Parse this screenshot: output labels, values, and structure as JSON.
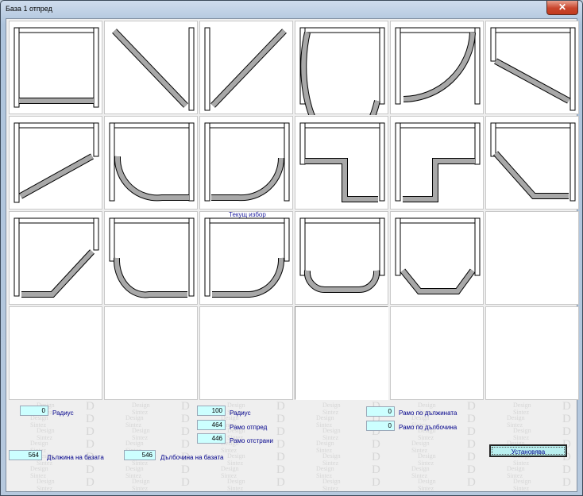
{
  "window": {
    "title": "База 1 отпред",
    "close_symbol": "✕"
  },
  "grid": {
    "current_selection_label": "Текущ избор",
    "shapes": [
      "rectangle",
      "diagonal-down",
      "diagonal-left",
      "quarter-arc",
      "arc-right",
      "angled-right",
      "angled-left",
      "arc-small-left",
      "arc-small-right",
      "step-left",
      "step-right",
      "chamfer-right",
      "chamfer-left",
      "round-both",
      "round-right",
      "round-small",
      "chamfer-both",
      "",
      "",
      "",
      "",
      "",
      "",
      ""
    ]
  },
  "fields": {
    "radius_left": {
      "value": "0",
      "label": "Радиус"
    },
    "radius_center": {
      "value": "100",
      "label": "Радиус"
    },
    "arm_front": {
      "value": "464",
      "label": "Рамо отпред"
    },
    "arm_side": {
      "value": "446",
      "label": "Рамо отстрани"
    },
    "arm_length": {
      "value": "0",
      "label": "Рамо по дължината"
    },
    "arm_depth": {
      "value": "0",
      "label": "Рамо по дълбочина"
    },
    "base_length": {
      "value": "564",
      "label": "Дължина на базата"
    },
    "base_depth": {
      "value": "546",
      "label": "Дълбочина на базата"
    }
  },
  "apply_button": "Установява",
  "watermark": [
    "Design",
    "Sintez",
    "D"
  ]
}
